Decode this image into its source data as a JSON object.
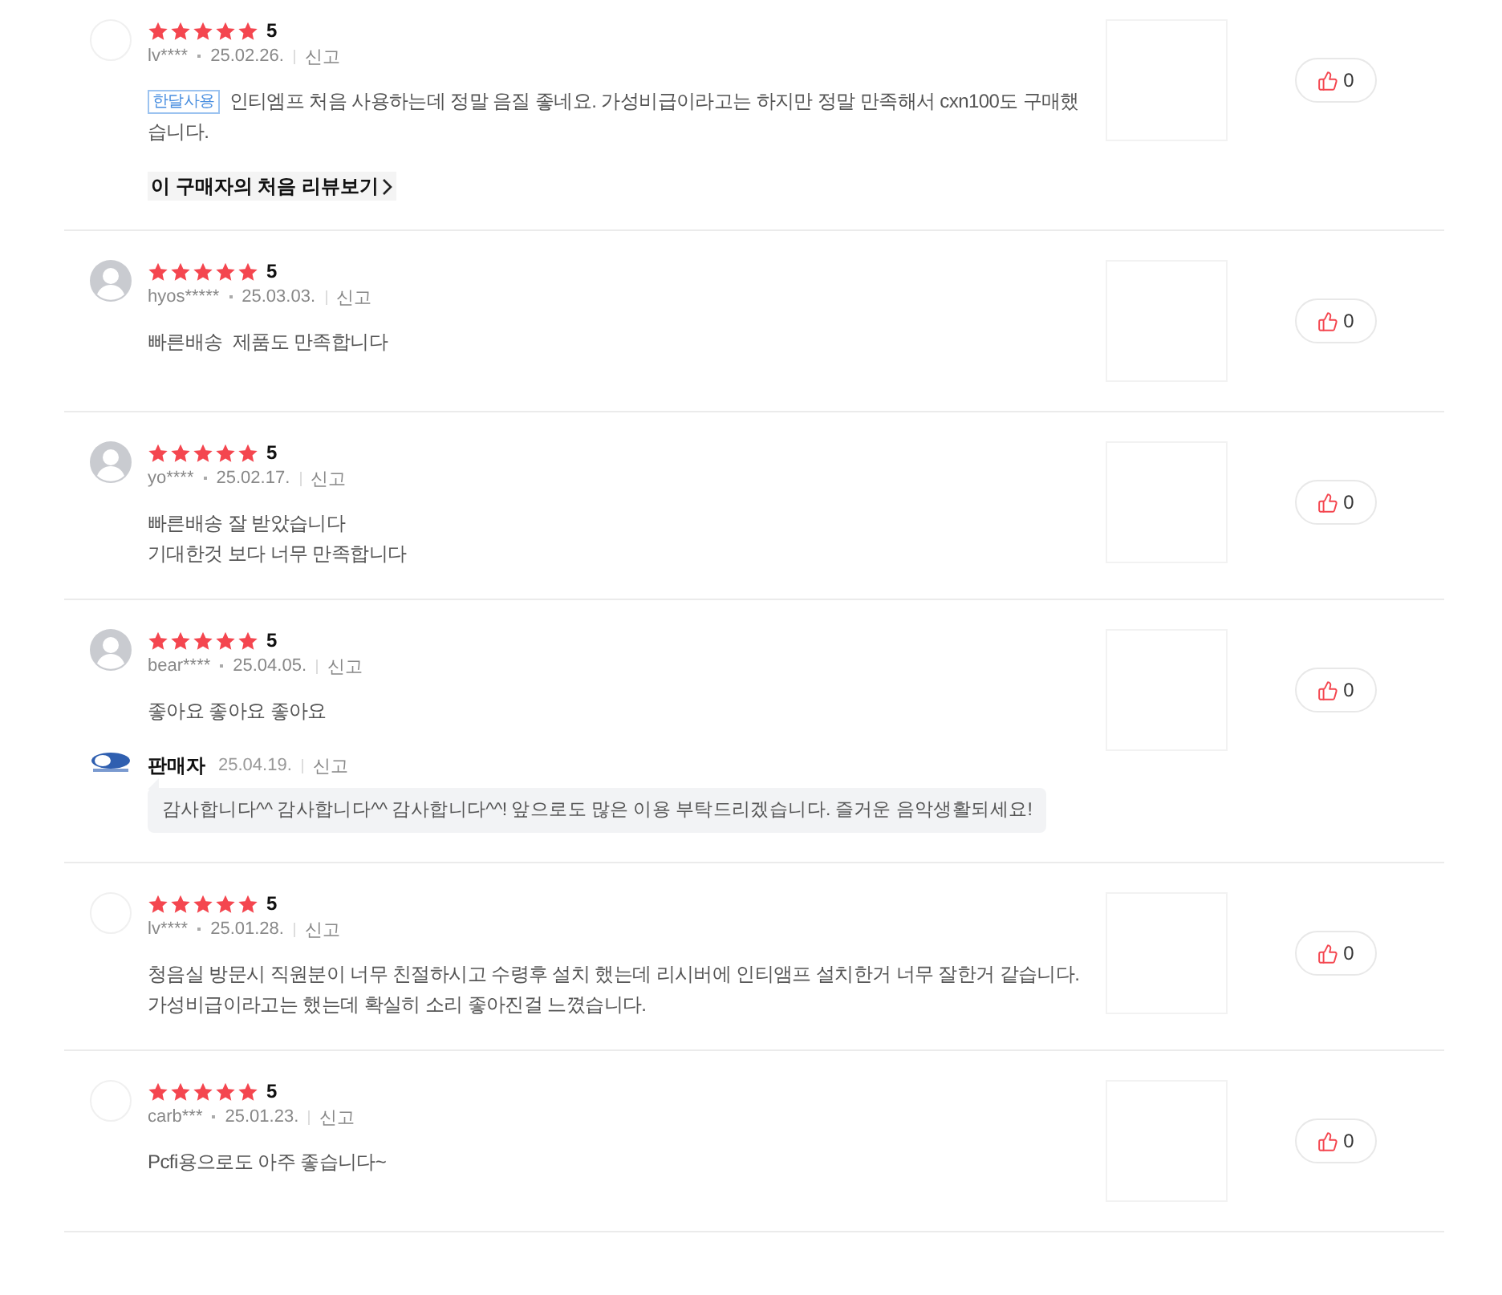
{
  "reviews": [
    {
      "default_avatar": false,
      "stars": 5,
      "rating": "5",
      "user": "lv****",
      "date": "25.02.26.",
      "report": "신고",
      "tag": "한달사용",
      "body": "인티엠프 처음 사용하는데 정말 음질 좋네요. 가성비급이라고는 하지만 정말 만족해서 cxn100도 구매했습니다.",
      "more_link": "이 구매자의 처음 리뷰보기",
      "likes": "0"
    },
    {
      "default_avatar": true,
      "stars": 5,
      "rating": "5",
      "user": "hyos*****",
      "date": "25.03.03.",
      "report": "신고",
      "body": "빠른배송  제품도 만족합니다",
      "likes": "0"
    },
    {
      "default_avatar": true,
      "stars": 5,
      "rating": "5",
      "user": "yo****",
      "date": "25.02.17.",
      "report": "신고",
      "body": "빠른배송 잘 받았습니다\n기대한것 보다 너무 만족합니다",
      "likes": "0"
    },
    {
      "default_avatar": true,
      "stars": 5,
      "rating": "5",
      "user": "bear****",
      "date": "25.04.05.",
      "report": "신고",
      "body": "좋아요 좋아요 좋아요",
      "seller_reply": {
        "label": "판매자",
        "date": "25.04.19.",
        "report": "신고",
        "text": "감사합니다^^ 감사합니다^^ 감사합니다^^! 앞으로도 많은 이용 부탁드리겠습니다. 즐거운 음악생활되세요!"
      },
      "likes": "0"
    },
    {
      "default_avatar": false,
      "stars": 5,
      "rating": "5",
      "user": "lv****",
      "date": "25.01.28.",
      "report": "신고",
      "body": "청음실 방문시 직원분이 너무 친절하시고 수령후 설치 했는데 리시버에 인티앰프 설치한거 너무 잘한거 같습니다. 가성비급이라고는 했는데 확실히 소리 좋아진걸 느꼈습니다.",
      "likes": "0"
    },
    {
      "default_avatar": false,
      "stars": 5,
      "rating": "5",
      "user": "carb***",
      "date": "25.01.23.",
      "report": "신고",
      "body": "Pcfi용으로도 아주 좋습니다~",
      "likes": "0"
    }
  ]
}
